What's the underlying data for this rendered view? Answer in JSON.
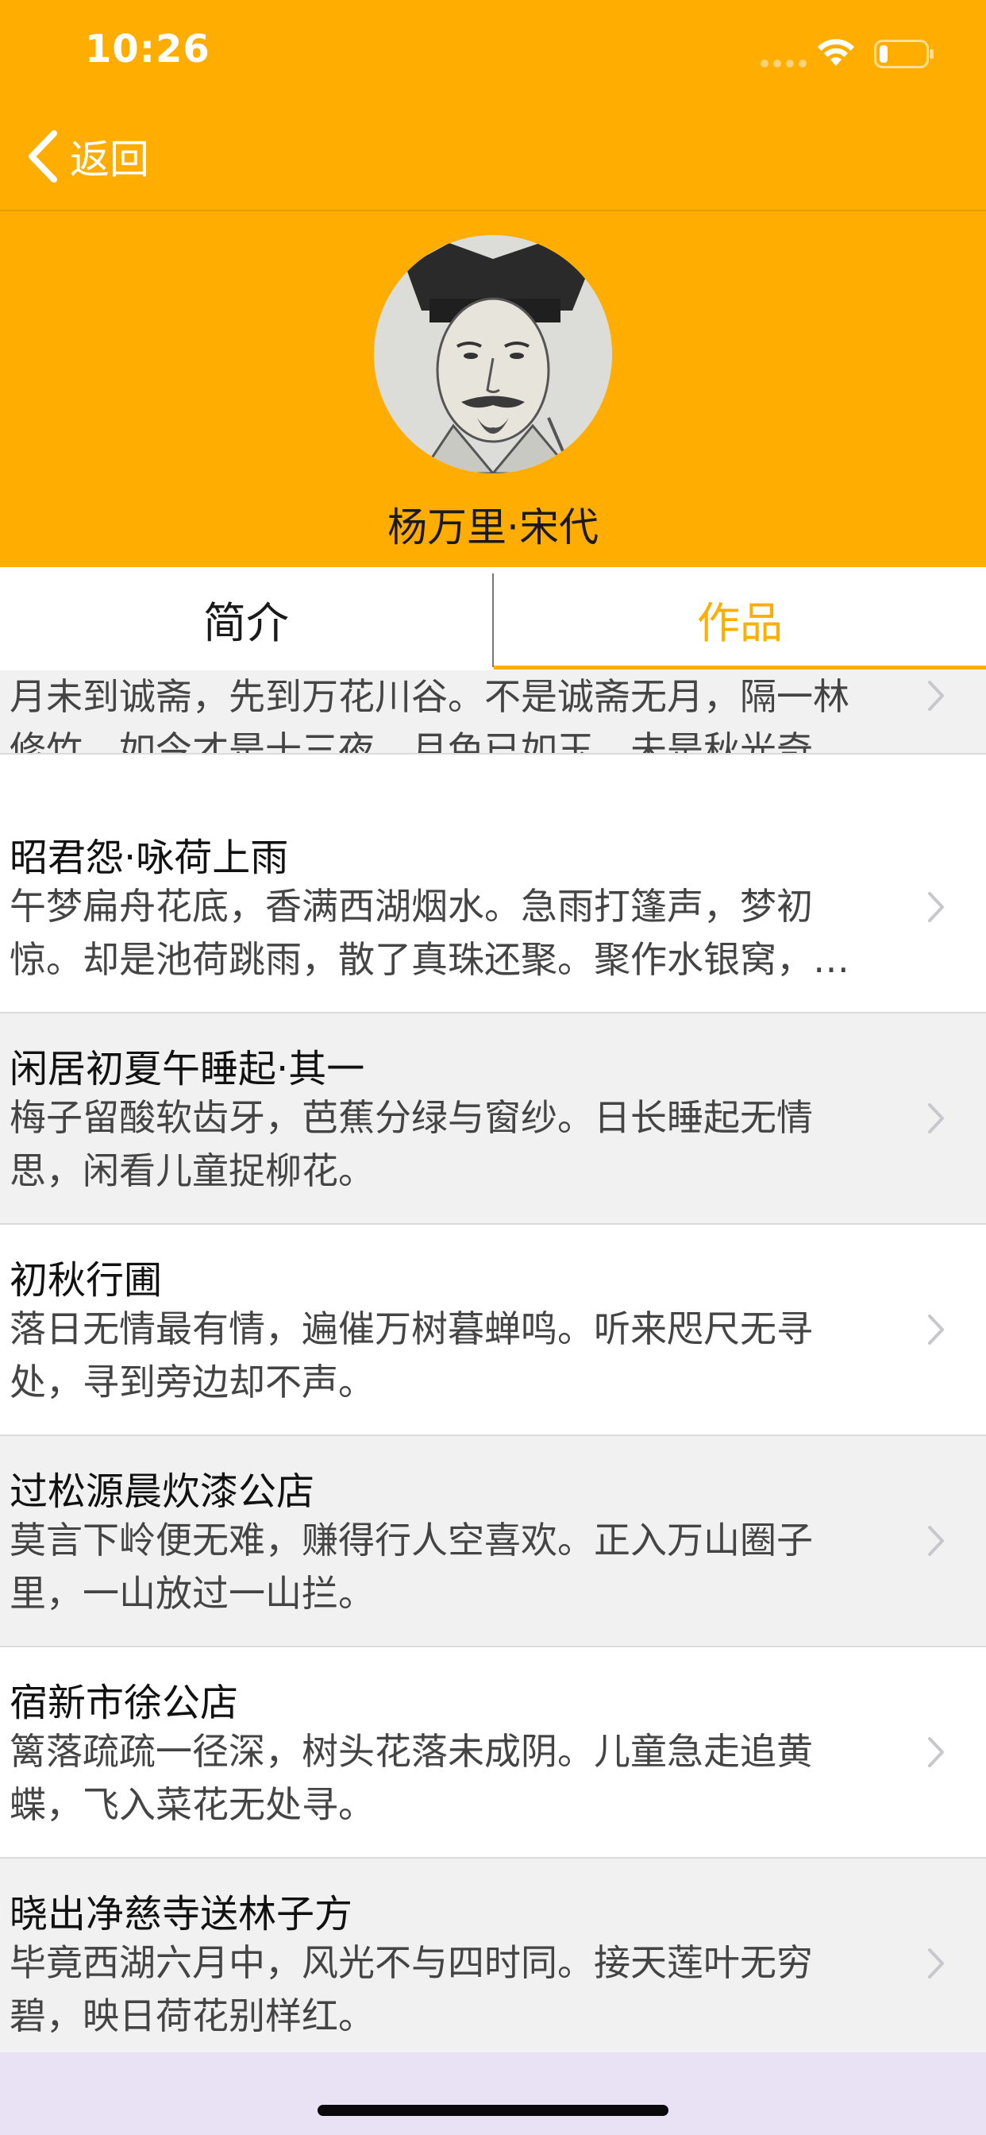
{
  "status_bar": {
    "time": "10:26"
  },
  "nav": {
    "back_label": "返回"
  },
  "profile": {
    "name": "杨万里·宋代"
  },
  "tabs": [
    {
      "label": "简介",
      "selected": false
    },
    {
      "label": "作品",
      "selected": true
    }
  ],
  "works": [
    {
      "title": "",
      "excerpt": "月未到诚斋，先到万花川谷。不是诚斋无月，隔一林修竹。如今才是十三夜，月色已如玉。未是秋光奇…"
    },
    {
      "title": "昭君怨·咏荷上雨",
      "excerpt": "午梦扁舟花底，香满西湖烟水。急雨打篷声，梦初惊。却是池荷跳雨，散了真珠还聚。聚作水银窝，…"
    },
    {
      "title": "闲居初夏午睡起·其一",
      "excerpt": "梅子留酸软齿牙，芭蕉分绿与窗纱。日长睡起无情思，闲看儿童捉柳花。"
    },
    {
      "title": "初秋行圃",
      "excerpt": "落日无情最有情，遍催万树暮蝉鸣。听来咫尺无寻处，寻到旁边却不声。"
    },
    {
      "title": "过松源晨炊漆公店",
      "excerpt": "莫言下岭便无难，赚得行人空喜欢。正入万山圈子里，一山放过一山拦。"
    },
    {
      "title": "宿新市徐公店",
      "excerpt": "篱落疏疏一径深，树头花落未成阴。儿童急走追黄蝶，飞入菜花无处寻。"
    },
    {
      "title": "晓出净慈寺送林子方",
      "excerpt": "毕竟西湖六月中，风光不与四时同。接天莲叶无穷碧，映日荷花别样红。"
    }
  ],
  "colors": {
    "accent": "#FFAD00",
    "row_alt": "#F1F1F1",
    "home_area": "#E9E2F5"
  }
}
